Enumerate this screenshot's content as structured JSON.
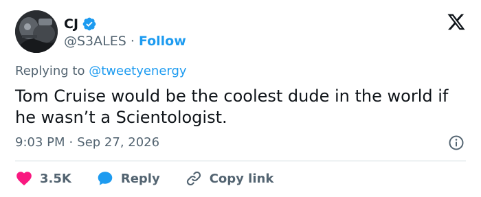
{
  "author": {
    "name": "CJ",
    "handle": "@S3ALES",
    "separator": "·",
    "follow_label": "Follow"
  },
  "reply_context": {
    "prefix": "Replying to",
    "mention": "@tweetyenergy"
  },
  "tweet": {
    "text": "Tom Cruise would be the coolest dude in the world if he wasn’t a Scientologist.",
    "time": "9:03 PM",
    "separator": "·",
    "date": "Sep 27, 2026"
  },
  "actions": {
    "like_count": "3.5K",
    "reply_label": "Reply",
    "copy_label": "Copy link"
  },
  "colors": {
    "accent": "#1d9bf0",
    "like": "#f91880",
    "text": "#0f1419",
    "muted": "#536471",
    "divider": "#cfd9de"
  },
  "icons": [
    "verified-badge-icon",
    "x-logo-icon",
    "info-icon",
    "heart-icon",
    "reply-bubble-icon",
    "link-icon"
  ]
}
